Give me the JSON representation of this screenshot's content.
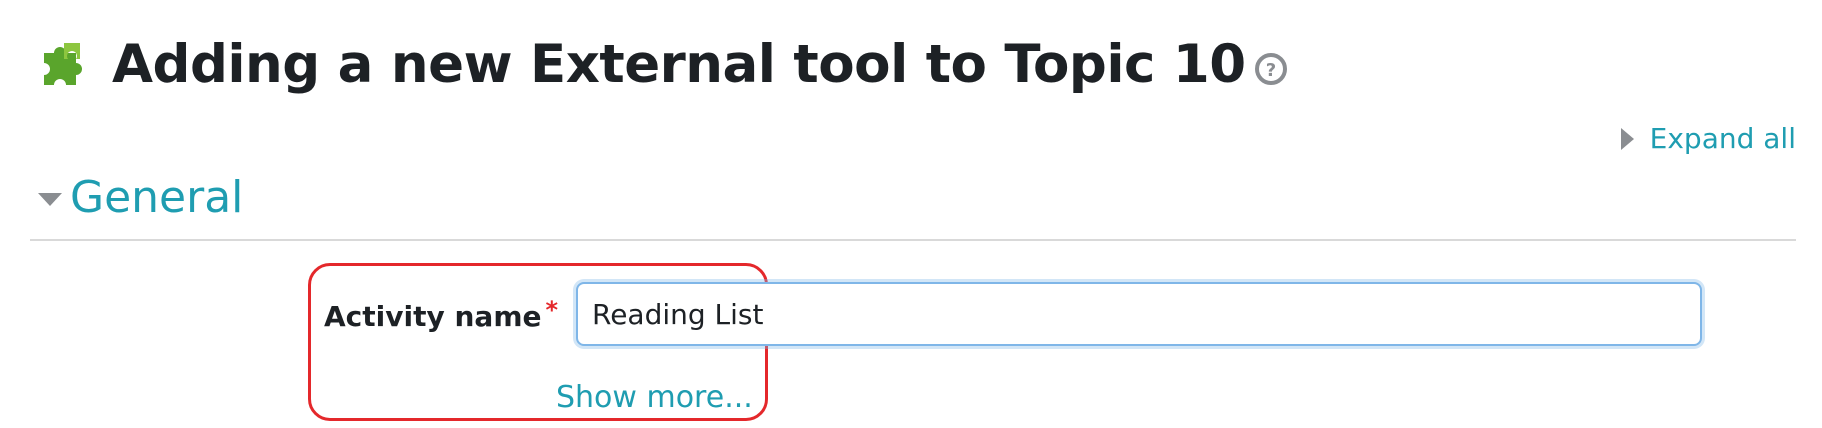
{
  "header": {
    "icon": "puzzle-piece-icon",
    "title": "Adding a new External tool to Topic 10",
    "help_icon": "question-circle-icon"
  },
  "expand_all": {
    "label": "Expand all",
    "icon": "triangle-right-icon"
  },
  "section": {
    "title": "General",
    "icon": "triangle-down-icon"
  },
  "form": {
    "activity_name": {
      "label": "Activity name",
      "required_marker": "*",
      "value": "Reading List"
    },
    "show_more_label": "Show more..."
  },
  "colors": {
    "link": "#1f9db1",
    "highlight": "#e4282b",
    "input_focus": "#7fb6e8",
    "icon_green": "#5aa52c"
  }
}
